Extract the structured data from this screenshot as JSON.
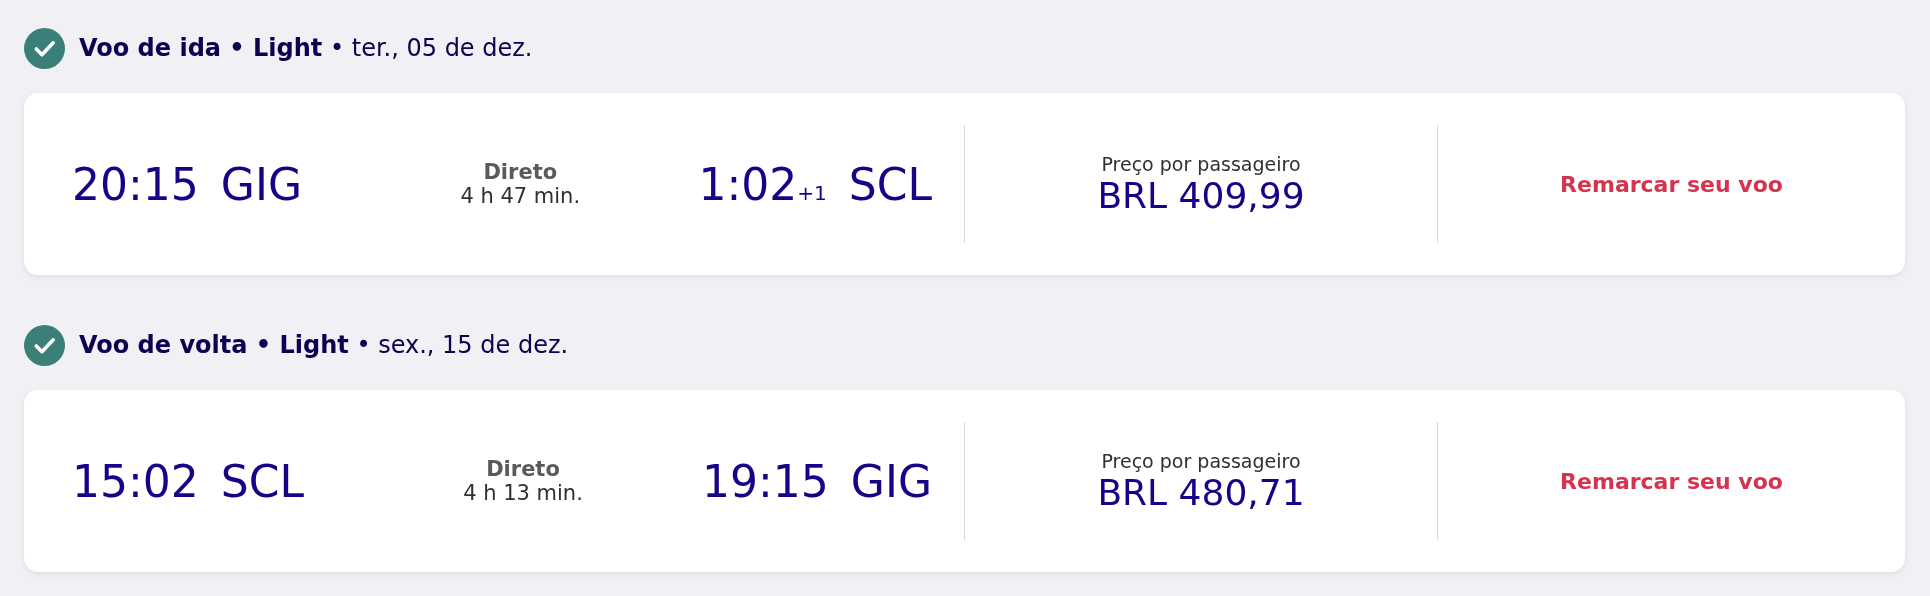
{
  "flights": [
    {
      "completed": true,
      "heading": "**Voo de ida • Light** • ter., 05 de dez.",
      "departure": {
        "time": "20:15",
        "airport": "GIG"
      },
      "stops": "Direto",
      "duration": "4 h 47 min.",
      "arrival": {
        "time": "1:02",
        "day_offset": "+1",
        "airport": "SCL"
      },
      "price_label": "Preço por passageiro",
      "price": "BRL 409,99",
      "action": "Remarcar seu voo"
    },
    {
      "completed": true,
      "heading": "**Voo de volta • Light** • sex., 15 de dez.",
      "departure": {
        "time": "15:02",
        "airport": "SCL"
      },
      "stops": "Direto",
      "duration": "4 h 13 min.",
      "arrival": {
        "time": "19:15",
        "airport": "GIG"
      },
      "price_label": "Preço por passageiro",
      "price": "BRL 480,71",
      "action": "Remarcar seu voo"
    }
  ]
}
